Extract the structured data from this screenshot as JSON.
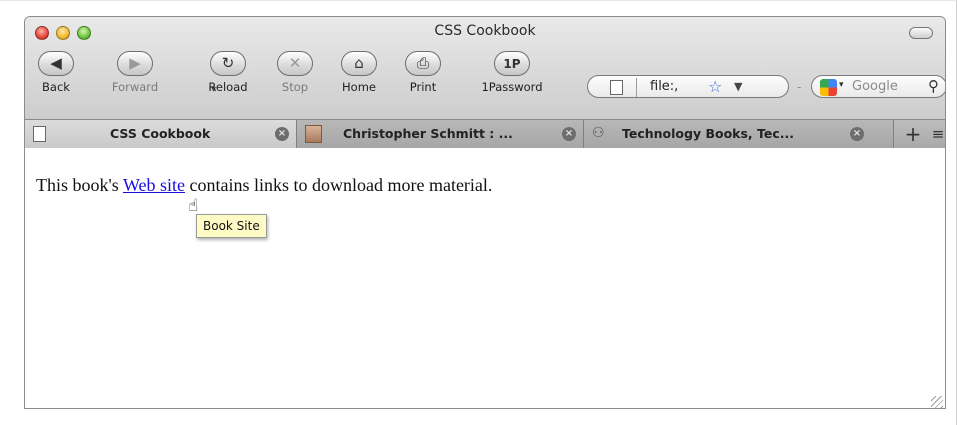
{
  "window": {
    "title": "CSS Cookbook"
  },
  "toolbar": {
    "back_label": "Back",
    "forward_label": "Forward",
    "reload_label": "Reload",
    "stop_label": "Stop",
    "home_label": "Home",
    "print_label": "Print",
    "onepassword_label": "1Password",
    "onepassword_glyph": "1P"
  },
  "address_bar": {
    "url": "file:,"
  },
  "search_bar": {
    "engine": "Google",
    "placeholder": "Google"
  },
  "tabs": [
    {
      "title": "CSS Cookbook",
      "active": true,
      "icon": "page-icon"
    },
    {
      "title": "Christopher Schmitt : ...",
      "active": false,
      "icon": "face-photo-icon"
    },
    {
      "title": "Technology Books, Tec...",
      "active": false,
      "icon": "people-icon"
    }
  ],
  "content": {
    "text_before": "This book's ",
    "link_text": "Web site",
    "text_after": " contains links to download more material.",
    "tooltip": "Book Site"
  }
}
